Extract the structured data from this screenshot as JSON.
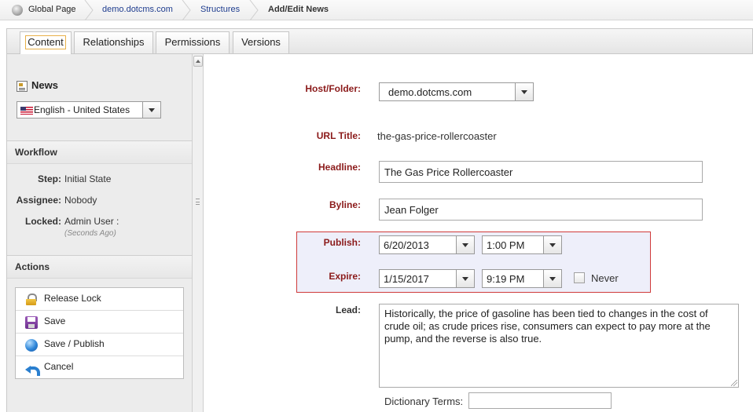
{
  "breadcrumb": {
    "items": [
      "Global Page",
      "demo.dotcms.com",
      "Structures",
      "Add/Edit News"
    ]
  },
  "tabs": [
    "Content",
    "Relationships",
    "Permissions",
    "Versions"
  ],
  "sidebar": {
    "structure_name": "News",
    "language": "English - United States",
    "workflow": {
      "title": "Workflow",
      "step_label": "Step:",
      "step_value": "Initial State",
      "assignee_label": "Assignee:",
      "assignee_value": "Nobody",
      "locked_label": "Locked:",
      "locked_value": "Admin User :",
      "locked_time": "(Seconds Ago)"
    },
    "actions": {
      "title": "Actions",
      "items": [
        "Release Lock",
        "Save",
        "Save / Publish",
        "Cancel"
      ]
    }
  },
  "form": {
    "host_folder_label": "Host/Folder:",
    "host_folder_value": "demo.dotcms.com",
    "url_title_label": "URL Title:",
    "url_title_value": "the-gas-price-rollercoaster",
    "headline_label": "Headline:",
    "headline_value": "The Gas Price Rollercoaster",
    "byline_label": "Byline:",
    "byline_value": "Jean Folger",
    "publish_label": "Publish:",
    "publish_date": "6/20/2013",
    "publish_time": "1:00 PM",
    "expire_label": "Expire:",
    "expire_date": "1/15/2017",
    "expire_time": "9:19 PM",
    "never_label": "Never",
    "lead_label": "Lead:",
    "lead_value": "Historically, the price of gasoline has been tied to changes in the cost of crude oil; as crude prices rise, consumers can expect to pay more at the pump, and the reverse is also true.",
    "dictionary_label": "Dictionary Terms:",
    "dictionary_value": ""
  },
  "colors": {
    "required_label": "#8b1a1a",
    "link": "#1f3d8f",
    "publish_border": "#cf3a3a",
    "publish_bg": "#eeeffa"
  }
}
